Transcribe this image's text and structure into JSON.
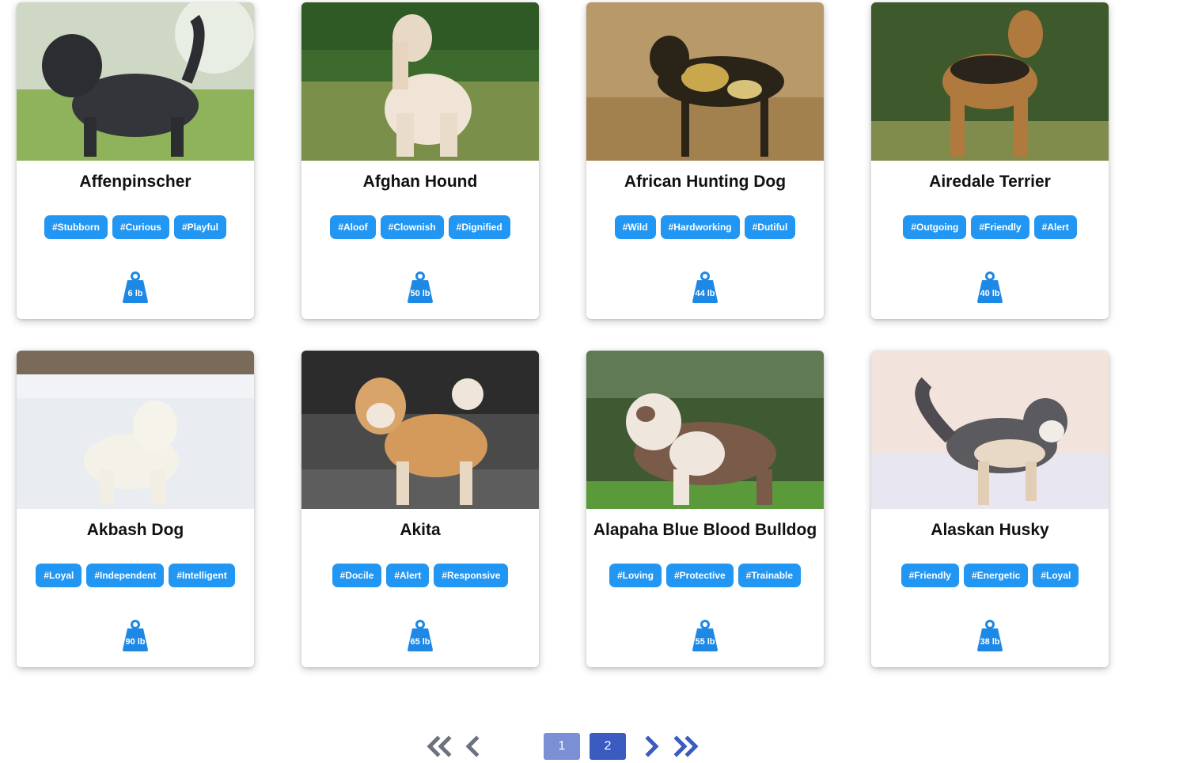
{
  "colors": {
    "tag": "#2196f3",
    "weight_icon": "#1e88e5",
    "page_current": "#7b8fd4",
    "page_other": "#3a5bbf",
    "nav_disabled": "#6b7280",
    "nav_enabled": "#3a5bbf"
  },
  "dogs": [
    {
      "name": "Affenpinscher",
      "tags": [
        "#Stubborn",
        "#Curious",
        "#Playful"
      ],
      "weight": "6 lb",
      "image": "shaggy-black-dog-on-grass"
    },
    {
      "name": "Afghan Hound",
      "tags": [
        "#Aloof",
        "#Clownish",
        "#Dignified"
      ],
      "weight": "50 lb",
      "image": "long-haired-cream-hound-on-grass"
    },
    {
      "name": "African Hunting Dog",
      "tags": [
        "#Wild",
        "#Hardworking",
        "#Dutiful"
      ],
      "weight": "44 lb",
      "image": "mottled-wild-dog-in-dry-grass"
    },
    {
      "name": "Airedale Terrier",
      "tags": [
        "#Outgoing",
        "#Friendly",
        "#Alert"
      ],
      "weight": "40 lb",
      "image": "tan-terrier-in-front-of-ivy"
    },
    {
      "name": "Akbash Dog",
      "tags": [
        "#Loyal",
        "#Independent",
        "#Intelligent"
      ],
      "weight": "90 lb",
      "image": "white-dog-in-snow"
    },
    {
      "name": "Akita",
      "tags": [
        "#Docile",
        "#Alert",
        "#Responsive"
      ],
      "weight": "65 lb",
      "image": "red-akita-on-pavement"
    },
    {
      "name": "Alapaha Blue Blood Bulldog",
      "tags": [
        "#Loving",
        "#Protective",
        "#Trainable"
      ],
      "weight": "55 lb",
      "image": "brown-white-bulldog-on-grass"
    },
    {
      "name": "Alaskan Husky",
      "tags": [
        "#Friendly",
        "#Energetic",
        "#Loyal"
      ],
      "weight": "38 lb",
      "image": "husky-running-in-snow"
    }
  ],
  "pagination": {
    "first_icon": "double-chevron-left-icon",
    "prev_icon": "chevron-left-icon",
    "next_icon": "chevron-right-icon",
    "last_icon": "double-chevron-right-icon",
    "pages": [
      "1",
      "2"
    ],
    "current_page": "1"
  }
}
